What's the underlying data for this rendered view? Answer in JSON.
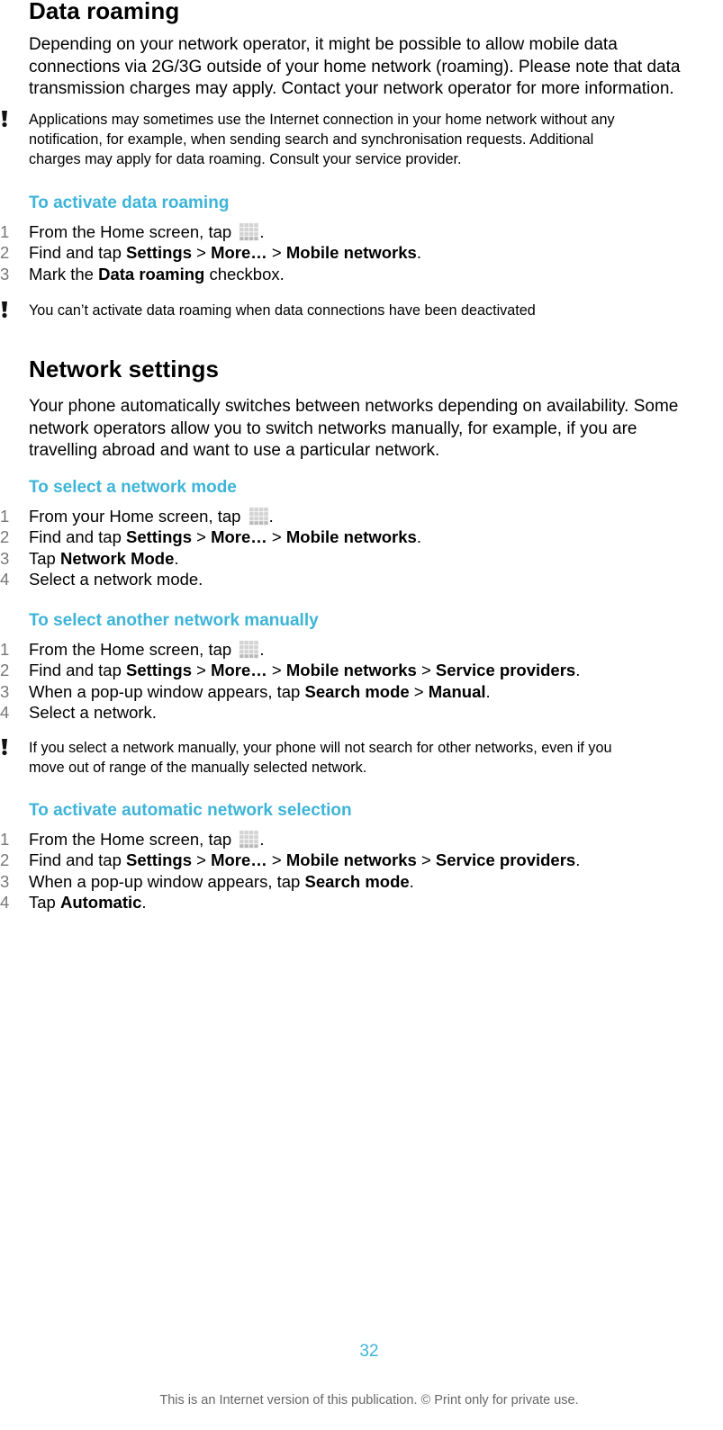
{
  "sections": {
    "data_roaming": {
      "title": "Data roaming",
      "body_lines": [
        "Depending on your network operator, it might be possible to allow mobile data",
        "connections via 2G/3G outside of your home network (roaming). Please note that data",
        "transmission charges may apply. Contact your network operator for more information."
      ],
      "note1_lines": [
        "Applications may sometimes use the Internet connection in your home network without any",
        "notification, for example, when sending search and synchronisation requests. Additional",
        "charges may apply for data roaming. Consult your service provider."
      ],
      "procedure": {
        "title": "To activate data roaming",
        "steps": [
          {
            "num": "1",
            "parts": [
              {
                "t": "From the Home screen, tap "
              },
              {
                "icon": "apps-grid-icon"
              },
              {
                "t": "."
              }
            ]
          },
          {
            "num": "2",
            "parts": [
              {
                "t": "Find and tap "
              },
              {
                "b": "Settings"
              },
              {
                "t": " > "
              },
              {
                "b": "More…"
              },
              {
                "t": " > "
              },
              {
                "b": "Mobile networks"
              },
              {
                "t": "."
              }
            ]
          },
          {
            "num": "3",
            "parts": [
              {
                "t": "Mark the "
              },
              {
                "b": "Data roaming"
              },
              {
                "t": " checkbox."
              }
            ]
          }
        ]
      },
      "note2_lines": [
        "You can’t activate data roaming when data connections have been deactivated"
      ]
    },
    "network_settings": {
      "title": "Network settings",
      "body_lines": [
        "Your phone automatically switches between networks depending on availability. Some",
        "network operators allow you to switch networks manually, for example, if you are",
        "travelling abroad and want to use a particular network."
      ],
      "procedures": [
        {
          "title": "To select a network mode",
          "steps": [
            {
              "num": "1",
              "parts": [
                {
                  "t": "From your Home screen, tap "
                },
                {
                  "icon": "apps-grid-icon"
                },
                {
                  "t": "."
                }
              ]
            },
            {
              "num": "2",
              "parts": [
                {
                  "t": "Find and tap "
                },
                {
                  "b": "Settings"
                },
                {
                  "t": " > "
                },
                {
                  "b": "More…"
                },
                {
                  "t": " > "
                },
                {
                  "b": "Mobile networks"
                },
                {
                  "t": "."
                }
              ]
            },
            {
              "num": "3",
              "parts": [
                {
                  "t": "Tap "
                },
                {
                  "b": "Network Mode"
                },
                {
                  "t": "."
                }
              ]
            },
            {
              "num": "4",
              "parts": [
                {
                  "t": "Select a network mode."
                }
              ]
            }
          ]
        },
        {
          "title": "To select another network manually",
          "steps": [
            {
              "num": "1",
              "parts": [
                {
                  "t": "From the Home screen, tap "
                },
                {
                  "icon": "apps-grid-icon"
                },
                {
                  "t": "."
                }
              ]
            },
            {
              "num": "2",
              "parts": [
                {
                  "t": "Find and tap "
                },
                {
                  "b": "Settings"
                },
                {
                  "t": " > "
                },
                {
                  "b": "More…"
                },
                {
                  "t": " > "
                },
                {
                  "b": "Mobile networks"
                },
                {
                  "t": " > "
                },
                {
                  "b": "Service providers"
                },
                {
                  "t": "."
                }
              ]
            },
            {
              "num": "3",
              "parts": [
                {
                  "t": "When a pop-up window appears, tap "
                },
                {
                  "b": "Search mode"
                },
                {
                  "t": " > "
                },
                {
                  "b": "Manual"
                },
                {
                  "t": "."
                }
              ]
            },
            {
              "num": "4",
              "parts": [
                {
                  "t": "Select a network."
                }
              ]
            }
          ]
        },
        {
          "title": "To activate automatic network selection",
          "steps": [
            {
              "num": "1",
              "parts": [
                {
                  "t": "From the Home screen, tap "
                },
                {
                  "icon": "apps-grid-icon"
                },
                {
                  "t": "."
                }
              ]
            },
            {
              "num": "2",
              "parts": [
                {
                  "t": "Find and tap "
                },
                {
                  "b": "Settings"
                },
                {
                  "t": " > "
                },
                {
                  "b": "More…"
                },
                {
                  "t": " > "
                },
                {
                  "b": "Mobile networks"
                },
                {
                  "t": " > "
                },
                {
                  "b": "Service providers"
                },
                {
                  "t": "."
                }
              ]
            },
            {
              "num": "3",
              "parts": [
                {
                  "t": "When a pop-up window appears, tap "
                },
                {
                  "b": "Search mode"
                },
                {
                  "t": "."
                }
              ]
            },
            {
              "num": "4",
              "parts": [
                {
                  "t": "Tap "
                },
                {
                  "b": "Automatic"
                },
                {
                  "t": "."
                }
              ]
            }
          ]
        }
      ],
      "note_lines": [
        "If you select a network manually, your phone will not search for other networks, even if you",
        "move out of range of the manually selected network."
      ]
    }
  },
  "page_number": "32",
  "footer": "This is an Internet version of this publication. © Print only for private use.",
  "colors": {
    "heading_accent": "#3db4d8",
    "step_number": "#777777",
    "footer_text": "#666666"
  }
}
